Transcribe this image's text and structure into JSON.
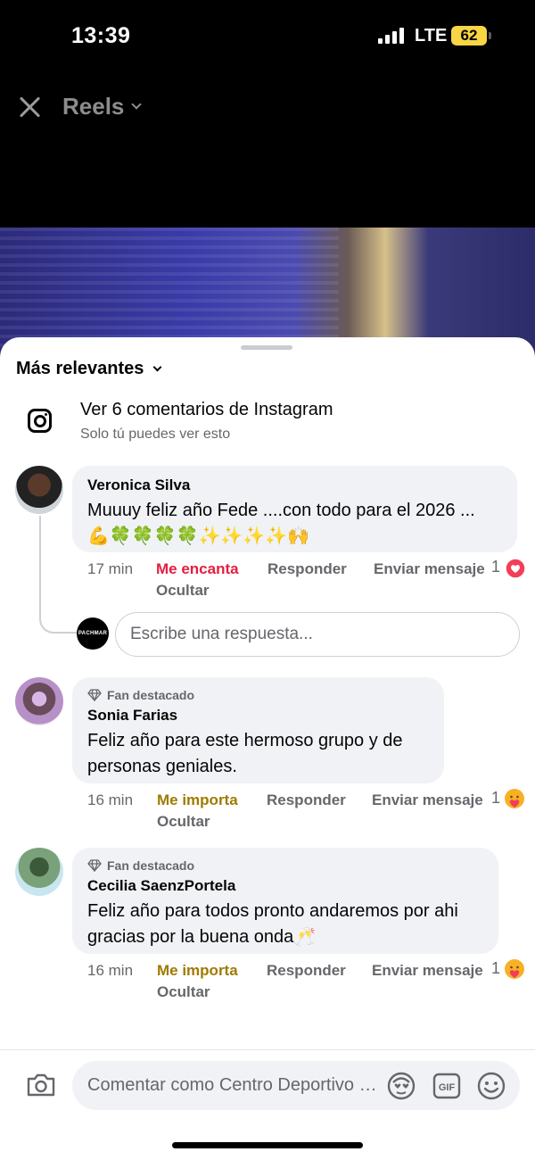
{
  "status_bar": {
    "time": "13:39",
    "network": "LTE",
    "battery": "62"
  },
  "header": {
    "title": "Reels"
  },
  "sheet": {
    "sort_label": "Más relevantes",
    "instagram": {
      "title": "Ver 6 comentarios de Instagram",
      "subtitle": "Solo tú puedes ver esto"
    }
  },
  "comments": [
    {
      "author": "Veronica Silva",
      "badge": "",
      "text": "Muuuy feliz año Fede ....con todo para el 2026 ...\n💪🍀🍀🍀🍀✨✨✨✨🙌",
      "time": "17 min",
      "reaction_label": "Me encanta",
      "reply_label": "Responder",
      "message_label": "Enviar mensaje",
      "hide_label": "Ocultar",
      "reaction_count": "1",
      "reaction_icon": "love-react-icon"
    },
    {
      "author": "Sonia Farias",
      "badge": "Fan destacado",
      "text": "Feliz año para este hermoso grupo  y de\npersonas geniales.",
      "time": "16 min",
      "reaction_label": "Me importa",
      "reply_label": "Responder",
      "message_label": "Enviar mensaje",
      "hide_label": "Ocultar",
      "reaction_count": "1",
      "reaction_icon": "care-react-icon"
    },
    {
      "author": "Cecilia SaenzPortela",
      "badge": "Fan destacado",
      "text": "Feliz año para todos pronto andaremos por ahi\ngracias por la buena onda🥂",
      "time": "16 min",
      "reaction_label": "Me importa",
      "reply_label": "Responder",
      "message_label": "Enviar mensaje",
      "hide_label": "Ocultar",
      "reaction_count": "1",
      "reaction_icon": "care-react-icon"
    }
  ],
  "reply_box": {
    "avatar_text": "PACHMAR",
    "placeholder": "Escribe una respuesta..."
  },
  "composer": {
    "placeholder": "Comentar como Centro Deportivo Pachmar"
  },
  "colors": {
    "love": "#e41e3f",
    "care": "#a07a00",
    "bubble": "#f0f2f5",
    "muted": "#65676b"
  }
}
